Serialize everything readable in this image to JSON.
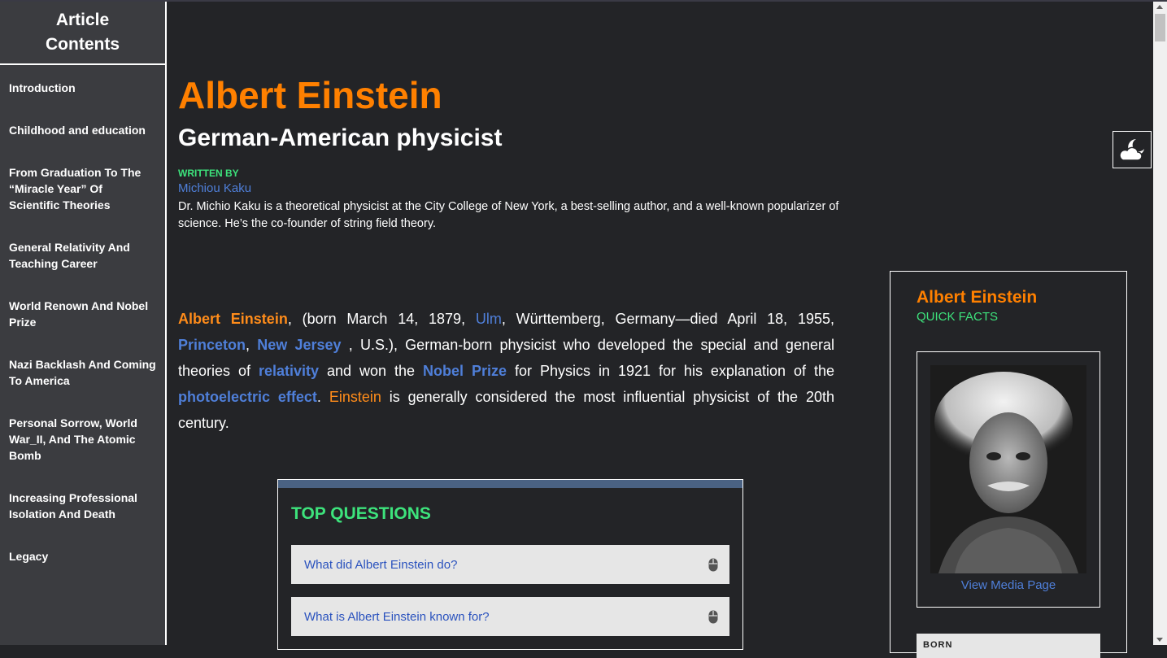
{
  "sidebar": {
    "title": "Article Contents",
    "items": [
      {
        "label": "Introduction"
      },
      {
        "label": "Childhood and education"
      },
      {
        "label": "From Graduation To The “Miracle Year” Of Scientific Theories"
      },
      {
        "label": "General Relativity And Teaching Career"
      },
      {
        "label": "World Renown And Nobel Prize"
      },
      {
        "label": "Nazi Backlash And Coming To America"
      },
      {
        "label": "Personal Sorrow, World War_II, And The Atomic Bomb"
      },
      {
        "label": "Increasing Professional Isolation And Death"
      },
      {
        "label": "Legacy"
      }
    ]
  },
  "theme_toggle": {
    "icon": "moon-cloud-icon"
  },
  "header": {
    "title": "Albert Einstein",
    "subtitle": "German-American physicist",
    "written_by_label": "WRITTEN BY",
    "author": "Michiou Kaku",
    "author_bio": "Dr. Michio Kaku is a theoretical physicist at the City College of New York, a best-selling author, and a well-known popularizer of science. He’s the co-founder of string field theory."
  },
  "intro": {
    "name": "Albert Einstein",
    "t1": ", (born March 14, 1879, ",
    "ulm": "Ulm",
    "t2": ", Württemberg, Germany—died April 18, 1955, ",
    "princeton": "Princeton",
    "t3": ", ",
    "new_jersey": "New Jersey",
    "t4": " , U.S.), German-born physicist who developed the special and general theories of ",
    "relativity": "relativity",
    "t5": " and won the ",
    "nobel": "Nobel Prize",
    "t6": " for Physics in 1921 for his explanation of the ",
    "photoelectric": "photoelectric effect",
    "t7": ". ",
    "einstein": "Einstein",
    "t8": " is generally considered the most influential physicist of the 20th century."
  },
  "top_questions": {
    "title": "TOP QUESTIONS",
    "items": [
      {
        "question": "What did Albert Einstein do?"
      },
      {
        "question": "What is Albert Einstein known for?"
      }
    ]
  },
  "quick_facts": {
    "name": "Albert Einstein",
    "label": "QUICK FACTS",
    "media_link": "View Media Page",
    "born_label": "BORN"
  },
  "colors": {
    "background": "#232427",
    "sidebar": "#3b3c40",
    "accent_orange": "#ff8000",
    "accent_green": "#3de37c",
    "link_blue": "#4f7fd9"
  }
}
